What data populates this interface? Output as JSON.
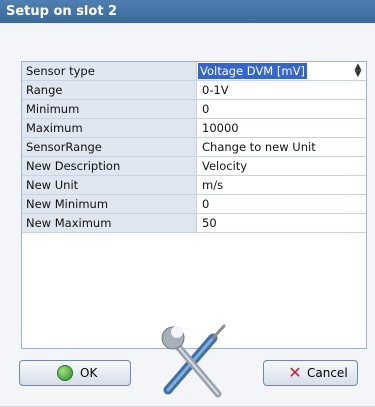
{
  "window": {
    "title": "Setup on slot 2"
  },
  "grid": {
    "rows": [
      {
        "label": "Sensor type",
        "value": "Voltage DVM  [mV]"
      },
      {
        "label": "Range",
        "value": "0-1V"
      },
      {
        "label": "Minimum",
        "value": "0"
      },
      {
        "label": "Maximum",
        "value": "10000"
      },
      {
        "label": "SensorRange",
        "value": "Change to new Unit"
      },
      {
        "label": "New Description",
        "value": "Velocity"
      },
      {
        "label": "New Unit",
        "value": "m/s"
      },
      {
        "label": "New Minimum",
        "value": "0"
      },
      {
        "label": "New Maximum",
        "value": "50"
      }
    ]
  },
  "buttons": {
    "ok_label": "OK",
    "cancel_label": "Cancel"
  },
  "icons": {
    "ok": "check-circle-icon",
    "cancel": "red-x-icon",
    "tools": "wrench-screwdriver-icon",
    "spinner": "updown-arrows-icon"
  }
}
